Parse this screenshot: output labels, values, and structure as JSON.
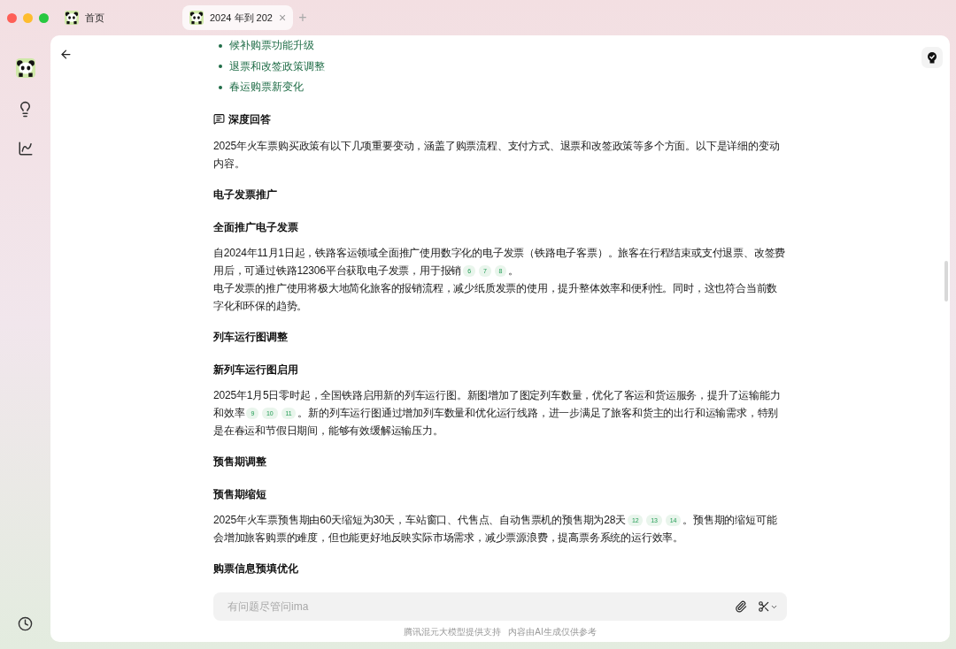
{
  "tabs": [
    {
      "label": "首页",
      "selected": false,
      "closable": false
    },
    {
      "label": "2024 年到 202",
      "selected": true,
      "closable": true
    }
  ],
  "tab_close": "×",
  "new_tab": "+",
  "sidebar": {
    "items": [
      {
        "kind": "logo"
      },
      {
        "kind": "bulb"
      },
      {
        "kind": "chart"
      }
    ],
    "bottom": {
      "kind": "history"
    }
  },
  "content": {
    "blocks": [
      {
        "kind": "bullet",
        "text": "候补购票功能升级"
      },
      {
        "kind": "bullet",
        "text": "退票和改签政策调整"
      },
      {
        "kind": "bullet",
        "text": "春运购票新变化"
      },
      {
        "kind": "section",
        "text": "深度回答"
      },
      {
        "kind": "paragraph",
        "parts": [
          {
            "kind": "text",
            "text": "2025年火车票购买政策有以下几项重要变动，涵盖了购票流程、支付方式、退票和改签政策等多个方面。以下是详细的变动内容。"
          }
        ]
      },
      {
        "kind": "heading",
        "text": "电子发票推广"
      },
      {
        "kind": "subheading",
        "text": "全面推广电子发票"
      },
      {
        "kind": "paragraph",
        "parts": [
          {
            "kind": "text",
            "text": "自2024年11月1日起，铁路客运领域全面推广使用数字化的电子发票（铁路电子客票）。旅客在行程结束或支付退票、改签费用后，可通过铁路12306平台获取电子发票，用于报销"
          },
          {
            "kind": "cite",
            "text": "6"
          },
          {
            "kind": "cite",
            "text": "7"
          },
          {
            "kind": "cite",
            "text": "8"
          },
          {
            "kind": "text",
            "text": "。"
          },
          {
            "kind": "break"
          },
          {
            "kind": "text",
            "text": "电子发票的推广使用将极大地简化旅客的报销流程，减少纸质发票的使用，提升整体效率和便利性。同时，这也符合当前数字化和环保的趋势。"
          }
        ]
      },
      {
        "kind": "heading",
        "text": "列车运行图调整"
      },
      {
        "kind": "subheading",
        "text": "新列车运行图启用"
      },
      {
        "kind": "paragraph",
        "parts": [
          {
            "kind": "text",
            "text": "2025年1月5日零时起，全国铁路启用新的列车运行图。新图增加了图定列车数量，优化了客运和货运服务，提升了运输能力和效率"
          },
          {
            "kind": "cite",
            "text": "9"
          },
          {
            "kind": "cite",
            "text": "10"
          },
          {
            "kind": "cite",
            "text": "11"
          },
          {
            "kind": "text",
            "text": "。新的列车运行图通过增加列车数量和优化运行线路，进一步满足了旅客和货主的出行和运输需求，特别是在春运和节假日期间，能够有效缓解运输压力。"
          }
        ]
      },
      {
        "kind": "heading",
        "text": "预售期调整"
      },
      {
        "kind": "subheading",
        "text": "预售期缩短"
      },
      {
        "kind": "paragraph",
        "parts": [
          {
            "kind": "text",
            "text": "2025年火车票预售期由60天缩短为30天，车站窗口、代售点、自动售票机的预售期为28天"
          },
          {
            "kind": "cite",
            "text": "12"
          },
          {
            "kind": "cite",
            "text": "13"
          },
          {
            "kind": "cite",
            "text": "14"
          },
          {
            "kind": "text",
            "text": "。预售期的缩短可能会增加旅客购票的难度，但也能更好地反映实际市场需求，减少票源浪费，提高票务系统的运行效率。"
          }
        ]
      },
      {
        "kind": "heading",
        "text": "购票信息预填优化"
      }
    ]
  },
  "input": {
    "placeholder": "有问题尽管问ima"
  },
  "footer": [
    "腾讯混元大模型提供支持",
    "内容由AI生成仅供参考"
  ]
}
